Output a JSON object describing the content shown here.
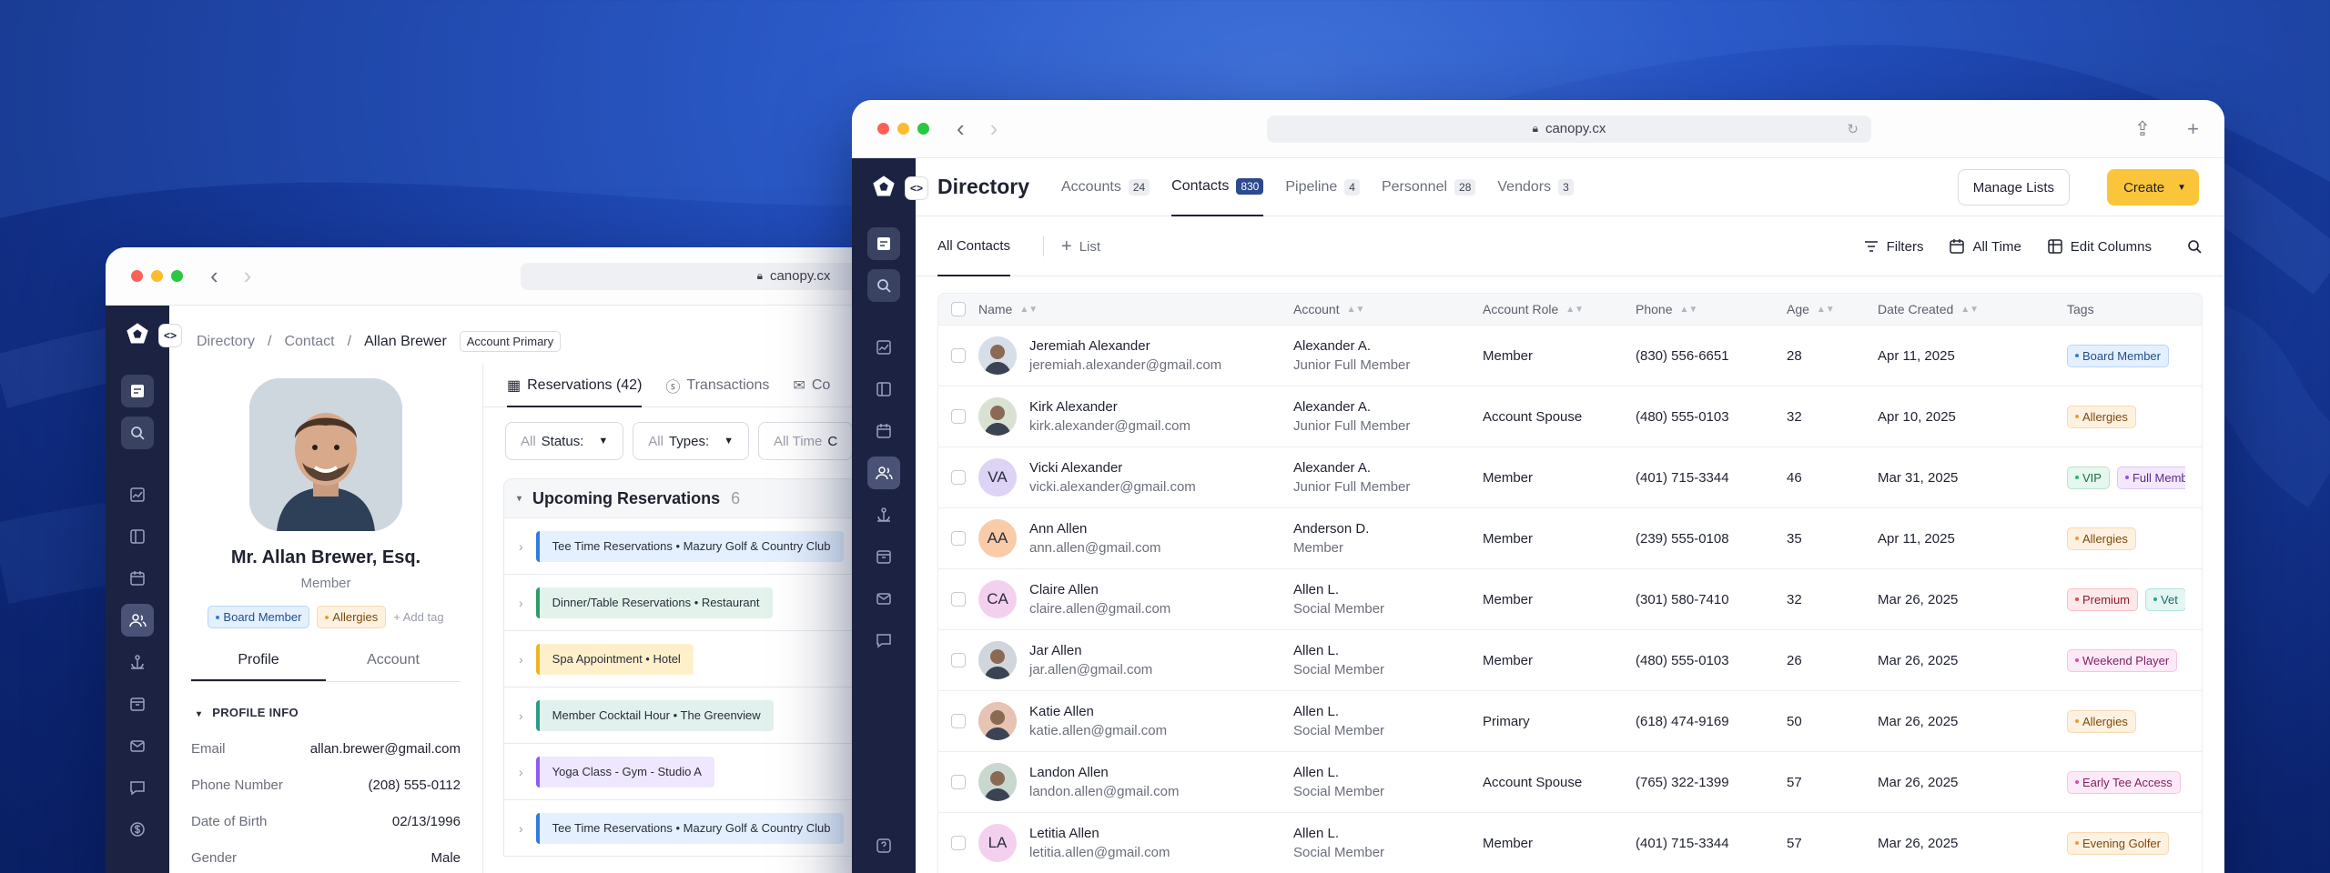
{
  "left_window": {
    "url": "canopy.cx",
    "breadcrumb": [
      "Directory",
      "Contact",
      "Allan Brewer"
    ],
    "breadcrumb_chip": "Account Primary",
    "profile": {
      "name": "Mr. Allan Brewer, Esq.",
      "role": "Member",
      "tags": [
        "Board Member",
        "Allergies"
      ],
      "add_tag": "+ Add tag",
      "tabs": [
        "Profile",
        "Account"
      ],
      "section": "PROFILE INFO",
      "fields": [
        {
          "label": "Email",
          "value": "allan.brewer@gmail.com"
        },
        {
          "label": "Phone Number",
          "value": "(208) 555-0112"
        },
        {
          "label": "Date of Birth",
          "value": "02/13/1996"
        },
        {
          "label": "Gender",
          "value": "Male"
        }
      ]
    },
    "tabs": [
      "Reservations (42)",
      "Transactions",
      "Co"
    ],
    "filters": [
      {
        "prefix": "All",
        "label": "Status:"
      },
      {
        "prefix": "All",
        "label": "Types:"
      },
      {
        "prefix": "All Time",
        "label": "C"
      }
    ],
    "group": {
      "title": "Upcoming Reservations",
      "count": "6"
    },
    "reservations": [
      "Tee Time Reservations • Mazury Golf & Country Club",
      "Dinner/Table Reservations • Restaurant",
      "Spa Appointment • Hotel",
      "Member Cocktail Hour • The Greenview",
      "Yoga Class - Gym - Studio A",
      "Tee Time Reservations • Mazury Golf & Country Club"
    ]
  },
  "right_window": {
    "url": "canopy.cx",
    "title": "Directory",
    "tabs": [
      {
        "label": "Accounts",
        "count": "24"
      },
      {
        "label": "Contacts",
        "count": "830"
      },
      {
        "label": "Pipeline",
        "count": "4"
      },
      {
        "label": "Personnel",
        "count": "28"
      },
      {
        "label": "Vendors",
        "count": "3"
      }
    ],
    "manage_lists": "Manage Lists",
    "create": "Create",
    "subtab": "All Contacts",
    "add_list": "List",
    "tools": [
      "Filters",
      "All Time",
      "Edit Columns"
    ],
    "columns": [
      "Name",
      "Account",
      "Account Role",
      "Phone",
      "Age",
      "Date Created",
      "Tags"
    ],
    "rows": [
      {
        "name": "Jeremiah Alexander",
        "email": "jeremiah.alexander@gmail.com",
        "account": "Alexander A.",
        "account_type": "Junior Full Member",
        "role": "Member",
        "phone": "(830) 556-6651",
        "age": "28",
        "date": "Apr 11, 2025",
        "tags": [
          "Board Member"
        ],
        "initials": ""
      },
      {
        "name": "Kirk Alexander",
        "email": "kirk.alexander@gmail.com",
        "account": "Alexander A.",
        "account_type": "Junior Full Member",
        "role": "Account Spouse",
        "phone": "(480) 555-0103",
        "age": "32",
        "date": "Apr 10, 2025",
        "tags": [
          "Allergies"
        ],
        "initials": ""
      },
      {
        "name": "Vicki Alexander",
        "email": "vicki.alexander@gmail.com",
        "account": "Alexander A.",
        "account_type": "Junior Full Member",
        "role": "Member",
        "phone": "(401) 715-3344",
        "age": "46",
        "date": "Mar 31, 2025",
        "tags": [
          "VIP",
          "Full Memb"
        ],
        "initials": "VA"
      },
      {
        "name": "Ann Allen",
        "email": "ann.allen@gmail.com",
        "account": "Anderson D.",
        "account_type": "Member",
        "role": "Member",
        "phone": "(239) 555-0108",
        "age": "35",
        "date": "Apr 11, 2025",
        "tags": [
          "Allergies"
        ],
        "initials": "AA"
      },
      {
        "name": "Claire Allen",
        "email": "claire.allen@gmail.com",
        "account": "Allen L.",
        "account_type": "Social Member",
        "role": "Member",
        "phone": "(301) 580-7410",
        "age": "32",
        "date": "Mar 26, 2025",
        "tags": [
          "Premium",
          "Vet"
        ],
        "initials": "CA"
      },
      {
        "name": "Jar Allen",
        "email": "jar.allen@gmail.com",
        "account": "Allen L.",
        "account_type": "Social Member",
        "role": "Member",
        "phone": "(480) 555-0103",
        "age": "26",
        "date": "Mar 26, 2025",
        "tags": [
          "Weekend Player"
        ],
        "initials": ""
      },
      {
        "name": "Katie Allen",
        "email": "katie.allen@gmail.com",
        "account": "Allen L.",
        "account_type": "Social Member",
        "role": "Primary",
        "phone": "(618) 474-9169",
        "age": "50",
        "date": "Mar 26, 2025",
        "tags": [
          "Allergies"
        ],
        "initials": ""
      },
      {
        "name": "Landon Allen",
        "email": "landon.allen@gmail.com",
        "account": "Allen L.",
        "account_type": "Social Member",
        "role": "Account Spouse",
        "phone": "(765) 322-1399",
        "age": "57",
        "date": "Mar 26, 2025",
        "tags": [
          "Early Tee Access"
        ],
        "initials": ""
      },
      {
        "name": "Letitia Allen",
        "email": "letitia.allen@gmail.com",
        "account": "Allen L.",
        "account_type": "Social Member",
        "role": "Member",
        "phone": "(401) 715-3344",
        "age": "57",
        "date": "Mar 26, 2025",
        "tags": [
          "Evening Golfer"
        ],
        "initials": "LA"
      }
    ]
  },
  "colors": {
    "rail": "#1c2342",
    "create_button": "#fac53a",
    "contacts_badge": "#2d4a8e"
  },
  "icons": [
    "chevron-left-icon",
    "chevron-right-icon",
    "lock-icon",
    "reload-icon",
    "share-icon",
    "plus-icon",
    "logo-icon",
    "search-icon",
    "chart-icon",
    "book-icon",
    "calendar-icon",
    "users-icon",
    "anchor-icon",
    "archive-icon",
    "mail-icon",
    "chat-icon",
    "dollar-icon",
    "help-icon",
    "filter-icon",
    "columns-icon"
  ]
}
